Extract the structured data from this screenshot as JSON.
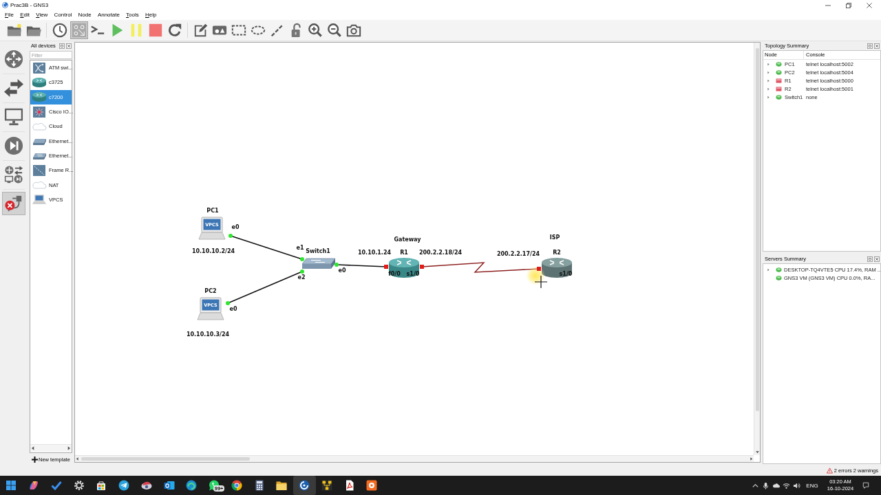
{
  "window": {
    "title": "Prac3B - GNS3"
  },
  "menu": [
    {
      "label": "File",
      "mnemonic": true
    },
    {
      "label": "Edit",
      "mnemonic": true
    },
    {
      "label": "View",
      "mnemonic": true
    },
    {
      "label": "Control",
      "mnemonic": false
    },
    {
      "label": "Node",
      "mnemonic": false
    },
    {
      "label": "Annotate",
      "mnemonic": false
    },
    {
      "label": "Tools",
      "mnemonic": true
    },
    {
      "label": "Help",
      "mnemonic": true
    }
  ],
  "toolbar": {
    "groups": [
      {
        "buttons": [
          {
            "kind": "new-project"
          },
          {
            "kind": "open-project"
          }
        ]
      },
      {
        "buttons": [
          {
            "kind": "snapshot"
          },
          {
            "kind": "interface-labels",
            "checked": true
          },
          {
            "kind": "console"
          },
          {
            "kind": "start"
          },
          {
            "kind": "suspend"
          },
          {
            "kind": "stop"
          },
          {
            "kind": "reload"
          }
        ]
      },
      {
        "buttons": [
          {
            "kind": "note"
          },
          {
            "kind": "picture"
          },
          {
            "kind": "rectangle"
          },
          {
            "kind": "ellipse"
          },
          {
            "kind": "line"
          },
          {
            "kind": "lock"
          },
          {
            "kind": "zoom-in"
          },
          {
            "kind": "zoom-out"
          },
          {
            "kind": "screenshot"
          }
        ]
      }
    ]
  },
  "device_types": [
    {
      "kind": "routers",
      "selected": false
    },
    {
      "kind": "switches",
      "selected": false
    },
    {
      "kind": "end-devices",
      "selected": false
    },
    {
      "kind": "security-devices",
      "selected": false
    },
    {
      "kind": "all-devices",
      "selected": false
    },
    {
      "kind": "add-link",
      "selected": true
    }
  ],
  "devices_panel": {
    "title": "All devices",
    "filter": {
      "placeholder": "Filter"
    },
    "items": [
      {
        "kind": "atm-switch",
        "label": "ATM swi...",
        "selected": false
      },
      {
        "kind": "router",
        "label": "c3725",
        "selected": false
      },
      {
        "kind": "router",
        "label": "c7200",
        "selected": true
      },
      {
        "kind": "iou",
        "label": "Cisco IO...",
        "selected": false
      },
      {
        "kind": "cloud",
        "label": "Cloud",
        "selected": false
      },
      {
        "kind": "hub",
        "label": "Ethernet...",
        "selected": false
      },
      {
        "kind": "switch",
        "label": "Ethernet...",
        "selected": false
      },
      {
        "kind": "frame-relay",
        "label": "Frame R...",
        "selected": false
      },
      {
        "kind": "cloud",
        "label": "NAT",
        "selected": false
      },
      {
        "kind": "vpcs",
        "label": "VPCS",
        "selected": false
      }
    ],
    "new_template": "New template"
  },
  "canvas": {
    "nodes": [
      {
        "kind": "vpcs",
        "label": "PC1",
        "screen_text": "VPCS"
      },
      {
        "kind": "vpcs",
        "label": "PC2",
        "screen_text": "VPCS"
      },
      {
        "kind": "switch",
        "label": "Switch1"
      },
      {
        "kind": "router",
        "label": "R1"
      },
      {
        "kind": "router",
        "label": "R2"
      }
    ],
    "links": [
      {
        "kind": "ethernet",
        "ends": [
          {
            "port": "e0",
            "up": true
          },
          {
            "port": "e1",
            "up": true
          }
        ]
      },
      {
        "kind": "ethernet",
        "ends": [
          {
            "port": "e0",
            "up": true
          },
          {
            "port": "e2",
            "up": true
          }
        ]
      },
      {
        "kind": "ethernet",
        "ends": [
          {
            "port": "e0",
            "up": true
          },
          {
            "port": "f0/0",
            "up": false
          }
        ]
      },
      {
        "kind": "serial",
        "ends": [
          {
            "port": "s1/0",
            "up": false
          },
          {
            "port": "s1/0",
            "up": false
          }
        ]
      }
    ],
    "notes": [
      "10.10.10.2/24",
      "10.10.10.3/24",
      "Gateway",
      "10.10.1.24",
      "200.2.2.18/24",
      "ISP",
      "200.2.2.17/24"
    ]
  },
  "topology_summary": {
    "title": "Topology Summary",
    "columns": [
      "Node",
      "Console"
    ],
    "rows": [
      {
        "node": "PC1",
        "console": "telnet localhost:5002",
        "running": true,
        "expanded": false
      },
      {
        "node": "PC2",
        "console": "telnet localhost:5004",
        "running": true,
        "expanded": false
      },
      {
        "node": "R1",
        "console": "telnet localhost:5000",
        "running": false,
        "expanded": false
      },
      {
        "node": "R2",
        "console": "telnet localhost:5001",
        "running": false,
        "expanded": false
      },
      {
        "node": "Switch1",
        "console": "none",
        "running": true,
        "expanded": false
      }
    ]
  },
  "servers_summary": {
    "title": "Servers Summary",
    "rows": [
      {
        "text": "DESKTOP-TQ4VTE5 CPU 17.4%, RAM ...",
        "expandable": true,
        "running": true
      },
      {
        "text": "GNS3 VM (GNS3 VM) CPU 0.0%, RA...",
        "expandable": false,
        "running": true
      }
    ]
  },
  "status_bar": {
    "message": "2 errors 2 warnings"
  },
  "taskbar": {
    "apps": [
      {
        "kind": "start",
        "selected": false
      },
      {
        "kind": "copilot",
        "selected": false
      },
      {
        "kind": "tasks",
        "selected": false
      },
      {
        "kind": "settings",
        "selected": false
      },
      {
        "kind": "store",
        "selected": false
      },
      {
        "kind": "telegram",
        "selected": false
      },
      {
        "kind": "disc",
        "selected": false
      },
      {
        "kind": "mail",
        "selected": false
      },
      {
        "kind": "edge",
        "selected": false
      },
      {
        "kind": "chat",
        "selected": false,
        "badge": "99+"
      },
      {
        "kind": "chrome",
        "selected": false
      },
      {
        "kind": "calculator",
        "selected": false
      },
      {
        "kind": "files",
        "selected": false
      },
      {
        "kind": "gns3",
        "selected": true
      },
      {
        "kind": "network",
        "selected": false
      },
      {
        "kind": "pdf",
        "selected": false
      },
      {
        "kind": "media",
        "selected": false
      }
    ],
    "tray": {
      "language": "ENG",
      "time": "03:20 AM",
      "date": "16-10-2024"
    }
  }
}
